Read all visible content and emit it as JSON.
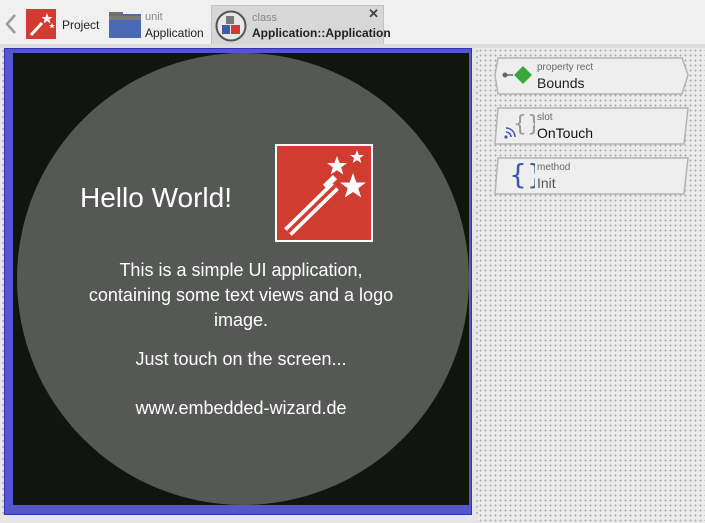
{
  "breadcrumb": {
    "project": {
      "label": "Project"
    },
    "unit": {
      "kind": "unit",
      "name": "Application"
    },
    "class": {
      "kind": "class",
      "name": "Application::Application",
      "close_glyph": "✕"
    }
  },
  "canvas": {
    "hello_text": "Hello World!",
    "paragraph1": [
      "This is a simple UI application,",
      "containing some text views and a logo",
      "image."
    ],
    "paragraph2": "Just touch on the screen...",
    "paragraph3": "www.embedded-wizard.de"
  },
  "members": [
    {
      "kind": "property rect",
      "name": "Bounds",
      "icon": "property-diamond-icon"
    },
    {
      "kind": "slot",
      "name": "OnTouch",
      "icon": "slot-braces-icon"
    },
    {
      "kind": "method",
      "name": "Init",
      "icon": "method-braces-icon"
    }
  ],
  "colors": {
    "logo_red": "#d13c31",
    "circle": "#565856",
    "screen": "#101511",
    "frame": "#5555cc",
    "property_green": "#3aa83a",
    "method_blue": "#3a5ca8"
  }
}
